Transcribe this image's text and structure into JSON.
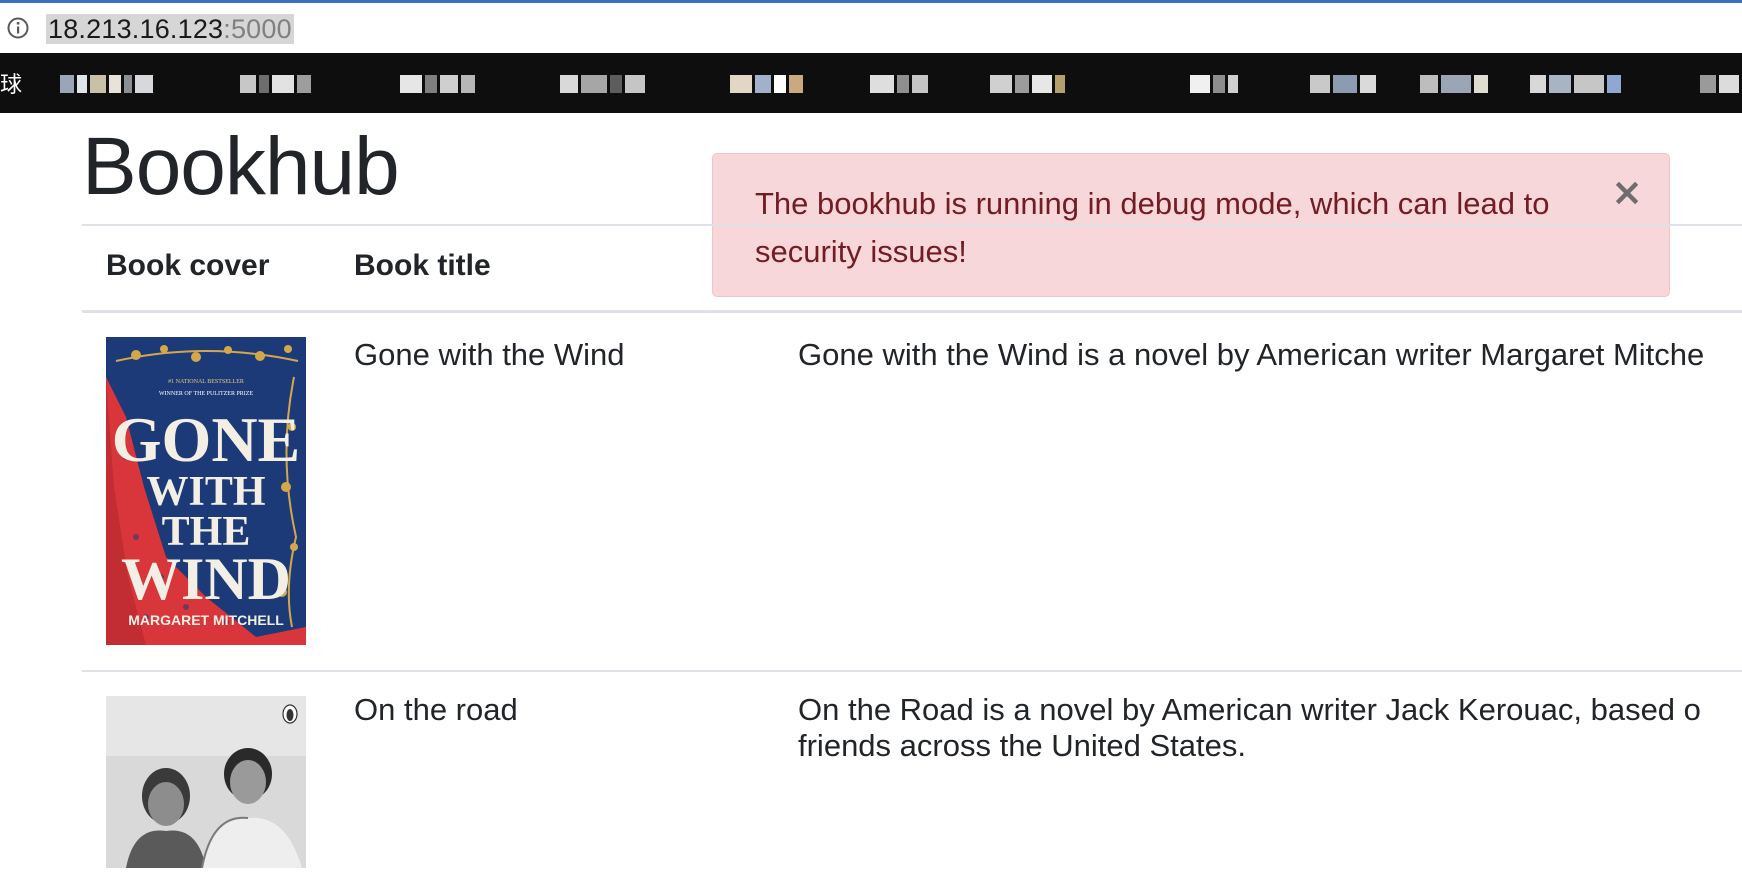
{
  "browser": {
    "url_host": "18.213.16.123",
    "url_port": ":5000",
    "bookmark_glyph": "球"
  },
  "page": {
    "title": "Bookhub"
  },
  "alert": {
    "message": "The bookhub is running in debug mode, which can lead to security issues!",
    "close_label": "×"
  },
  "table": {
    "headers": {
      "cover": "Book cover",
      "title": "Book title"
    },
    "rows": [
      {
        "title": "Gone with the Wind",
        "description": "Gone with the Wind is a novel by American writer Margaret Mitche",
        "cover": {
          "top_text": "#1 NATIONAL BESTSELLER",
          "prize_text": "WINNER OF THE PULITZER PRIZE",
          "line1": "GONE",
          "line2": "WITH",
          "line3": "THE",
          "line4": "WIND",
          "author": "MARGARET MITCHELL"
        }
      },
      {
        "title": "On the road",
        "description_line1": "On the Road is a novel by American writer Jack Kerouac, based o",
        "description_line2": "friends across the United States."
      }
    ]
  }
}
